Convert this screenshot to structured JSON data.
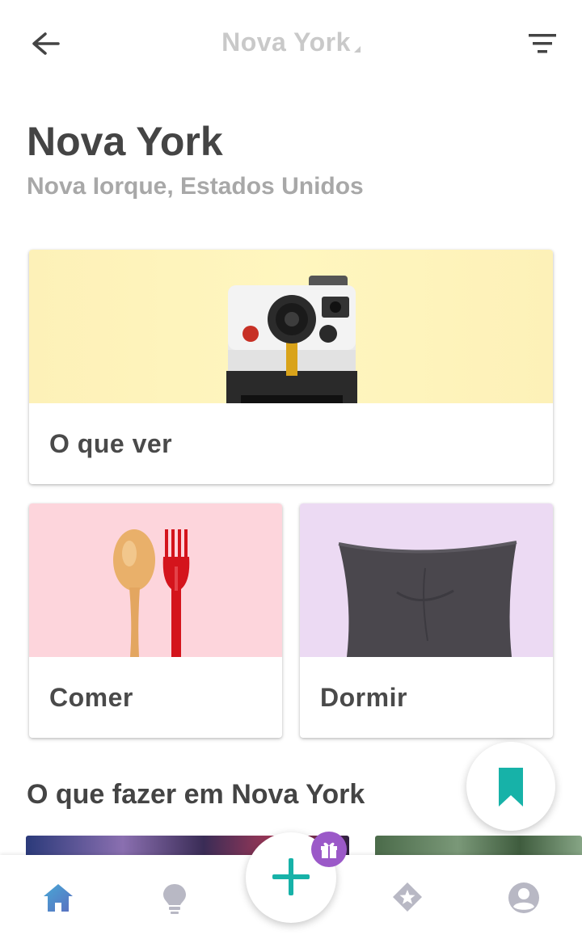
{
  "header": {
    "title": "Nova York",
    "back_icon": "arrow-left-icon",
    "filter_icon": "filter-icon"
  },
  "page": {
    "title": "Nova York",
    "subtitle": "Nova Iorque, Estados Unidos"
  },
  "categories": [
    {
      "label": "O que ver",
      "icon": "camera-image",
      "bg_color": "#fff3bd"
    },
    {
      "label": "Comer",
      "icon": "spoon-fork-image",
      "bg_color": "#fdd5dc"
    },
    {
      "label": "Dormir",
      "icon": "pillow-image",
      "bg_color": "#ecdaf3"
    }
  ],
  "section": {
    "title": "O que fazer em Nova York"
  },
  "bottom_nav": {
    "items": [
      "home-icon",
      "lightbulb-icon",
      "add-icon",
      "star-badge-icon",
      "account-icon"
    ],
    "active": "home-icon"
  },
  "colors": {
    "accent": "#17b2a8",
    "active_nav": "#4a90c2",
    "badge": "#9b59c8",
    "inactive_icon": "#b8b8c4"
  }
}
